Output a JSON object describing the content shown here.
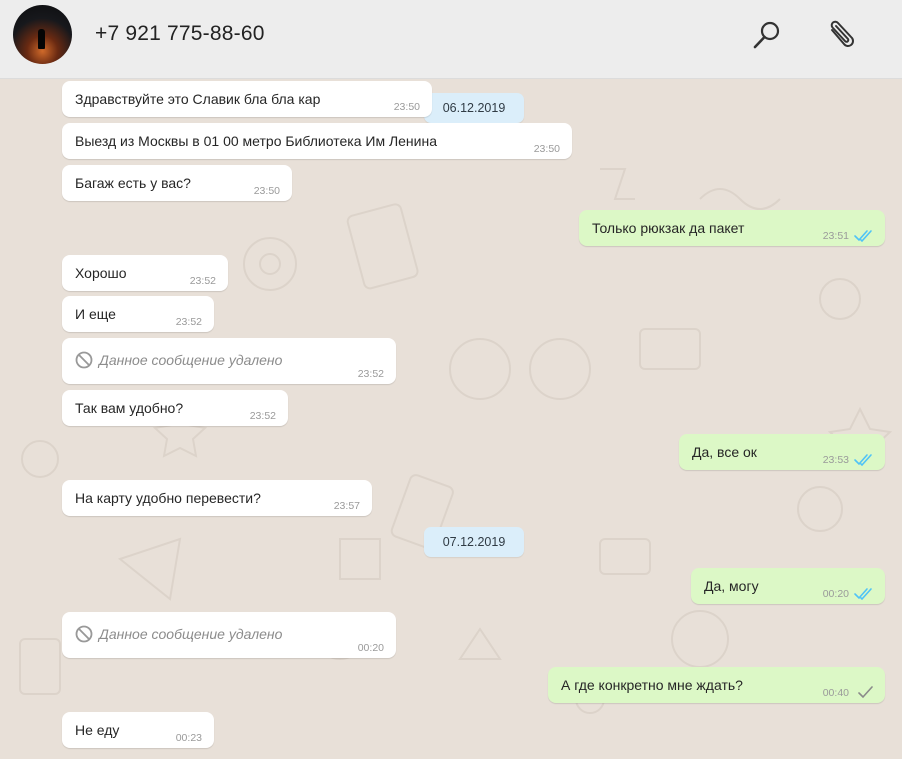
{
  "header": {
    "contact_name": "+7 921 775-88-60",
    "icons": [
      "search-icon",
      "paperclip-icon"
    ]
  },
  "colors": {
    "incoming_bubble": "#ffffff",
    "outgoing_bubble": "#dcf8c6",
    "date_chip": "#dbeefa",
    "tick_read": "#4fc3f7",
    "tick_sent": "#8a8a8a"
  },
  "dates": [
    "06.12.2019",
    "07.12.2019"
  ],
  "messages": [
    {
      "dir": "in",
      "text": "Здравствуйте это Славик бла бла кар",
      "time": "23:50"
    },
    {
      "dir": "in",
      "text": "Выезд из Москвы в 01 00 метро Библиотека Им Ленина",
      "time": "23:50"
    },
    {
      "dir": "in",
      "text": "Багаж есть у вас?",
      "time": "23:50"
    },
    {
      "dir": "out",
      "text": "Только рюкзак да пакет",
      "time": "23:51",
      "status": "read"
    },
    {
      "dir": "in",
      "text": "Хорошо",
      "time": "23:52"
    },
    {
      "dir": "in",
      "text": "И еще",
      "time": "23:52"
    },
    {
      "dir": "in",
      "text": "Данное сообщение удалено",
      "time": "23:52",
      "deleted": true
    },
    {
      "dir": "in",
      "text": "Так вам удобно?",
      "time": "23:52"
    },
    {
      "dir": "out",
      "text": "Да, все ок",
      "time": "23:53",
      "status": "read"
    },
    {
      "dir": "in",
      "text": "На карту удобно перевести?",
      "time": "23:57"
    },
    {
      "dir": "out",
      "text": "Да, могу",
      "time": "00:20",
      "status": "read"
    },
    {
      "dir": "in",
      "text": "Данное сообщение удалено",
      "time": "00:20",
      "deleted": true
    },
    {
      "dir": "out",
      "text": "А где конкретно мне ждать?",
      "time": "00:40",
      "status": "sent"
    },
    {
      "dir": "in",
      "text": "Не еду",
      "time": "00:23"
    }
  ]
}
